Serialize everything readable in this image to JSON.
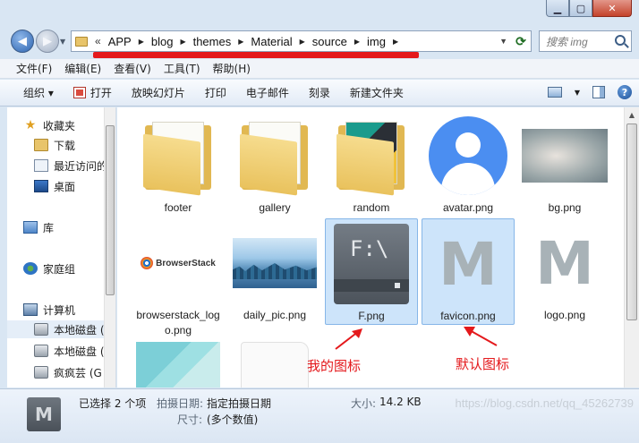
{
  "nav": {
    "breadcrumb": [
      "APP",
      "blog",
      "themes",
      "Material",
      "source",
      "img"
    ],
    "overflow_glyph": "«",
    "search_placeholder": "搜索 img"
  },
  "menu": [
    "文件(F)",
    "编辑(E)",
    "查看(V)",
    "工具(T)",
    "帮助(H)"
  ],
  "toolbar": {
    "organize": "组织 ▾",
    "open": "打开",
    "slideshow": "放映幻灯片",
    "print": "打印",
    "email": "电子邮件",
    "burn": "刻录",
    "new_folder": "新建文件夹"
  },
  "navpane": {
    "favorites": "收藏夹",
    "downloads": "下载",
    "recent": "最近访问的",
    "desktop": "桌面",
    "libraries": "库",
    "homegroup": "家庭组",
    "computer": "计算机",
    "disk1": "本地磁盘 (",
    "disk2": "本地磁盘 (",
    "disk3": "疯疯芸 (G"
  },
  "files": [
    {
      "name": "footer",
      "kind": "folder",
      "selected": false
    },
    {
      "name": "gallery",
      "kind": "folder",
      "selected": false
    },
    {
      "name": "random",
      "kind": "folder",
      "selected": false
    },
    {
      "name": "avatar.png",
      "kind": "image",
      "selected": false
    },
    {
      "name": "bg.png",
      "kind": "image",
      "selected": false
    },
    {
      "name": "browserstack_logo.png",
      "kind": "image",
      "selected": false
    },
    {
      "name": "daily_pic.png",
      "kind": "image",
      "selected": false
    },
    {
      "name": "F.png",
      "kind": "image",
      "selected": true
    },
    {
      "name": "favicon.png",
      "kind": "image",
      "selected": true
    },
    {
      "name": "logo.png",
      "kind": "image",
      "selected": false
    }
  ],
  "thumbs": {
    "browserstack_text": "BrowserStack",
    "drive_text": "F:\\",
    "m_glyph": "M"
  },
  "annotations": {
    "mine": "我的图标",
    "default": "默认图标"
  },
  "status": {
    "selected": "已选择 2 个项",
    "date_key": "拍摄日期:",
    "date_val": "指定拍摄日期",
    "size_key": "大小:",
    "size_val": "14.2 KB",
    "dims_key": "尺寸:",
    "dims_val": "(多个数值)",
    "watermark": "https://blog.csdn.net/qq_45262739"
  },
  "colors": {
    "annotation_red": "#e4191c",
    "selection_bg": "#cde4fa",
    "avatar_blue": "#4b8ef1"
  }
}
